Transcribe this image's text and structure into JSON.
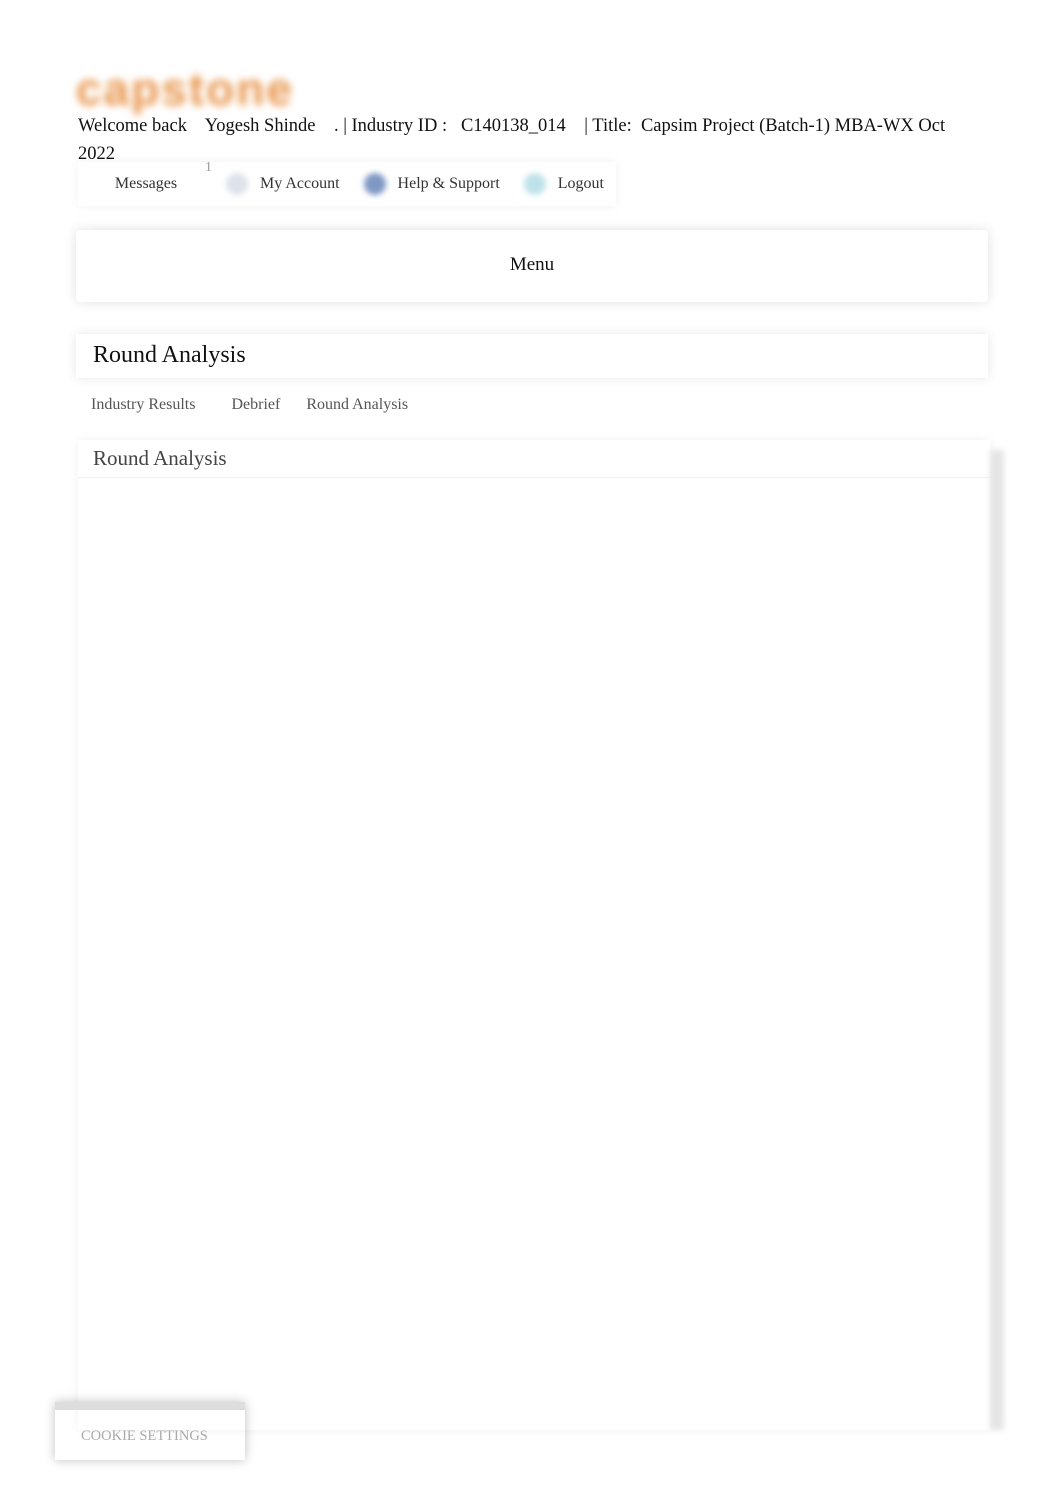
{
  "header": {
    "logo_text": "capstone",
    "welcome": "Welcome back    Yogesh Shinde    . | Industry ID :   C140138_014    | Title:  Capsim Project (Batch-1) MBA-WX Oct 2022"
  },
  "topnav": [
    {
      "label": "Messages",
      "badge": "1",
      "icon": "envelope-icon"
    },
    {
      "label": "My Account",
      "icon": "user-icon",
      "color": "#dde3ea"
    },
    {
      "label": "Help & Support",
      "icon": "help-icon",
      "color": "#7f98c4"
    },
    {
      "label": "Logout",
      "icon": "logout-icon",
      "color": "#bfe2ea"
    }
  ],
  "menu": {
    "label": "Menu"
  },
  "page_title": "Round Analysis",
  "tabs": [
    "Industry Results",
    "Debrief",
    "Round Analysis"
  ],
  "content_title": "Round Analysis",
  "cookie": "COOKIE SETTINGS"
}
